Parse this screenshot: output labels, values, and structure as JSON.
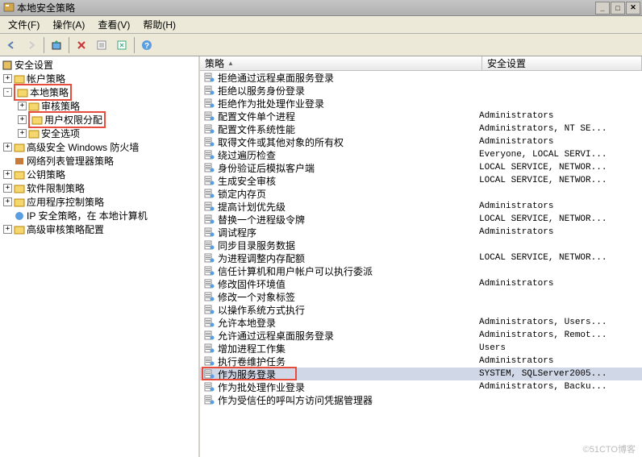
{
  "window": {
    "title": "本地安全策略"
  },
  "menu": {
    "file": "文件(F)",
    "action": "操作(A)",
    "view": "查看(V)",
    "help": "帮助(H)"
  },
  "tree": {
    "root": "安全设置",
    "account_policy": "帐户策略",
    "local_policy": "本地策略",
    "audit_policy": "审核策略",
    "user_rights": "用户权限分配",
    "security_options": "安全选项",
    "firewall": "高级安全 Windows 防火墙",
    "network_list": "网络列表管理器策略",
    "public_key": "公钥策略",
    "software_restriction": "软件限制策略",
    "app_control": "应用程序控制策略",
    "ip_security": "IP 安全策略，在 本地计算机",
    "advanced_audit": "高级审核策略配置"
  },
  "columns": {
    "policy": "策略",
    "security_setting": "安全设置"
  },
  "policies": [
    {
      "name": "拒绝通过远程桌面服务登录",
      "value": ""
    },
    {
      "name": "拒绝以服务身份登录",
      "value": ""
    },
    {
      "name": "拒绝作为批处理作业登录",
      "value": ""
    },
    {
      "name": "配置文件单个进程",
      "value": "Administrators"
    },
    {
      "name": "配置文件系统性能",
      "value": "Administrators, NT SE..."
    },
    {
      "name": "取得文件或其他对象的所有权",
      "value": "Administrators"
    },
    {
      "name": "绕过遍历检查",
      "value": "Everyone, LOCAL SERVI..."
    },
    {
      "name": "身份验证后模拟客户端",
      "value": "LOCAL SERVICE, NETWOR..."
    },
    {
      "name": "生成安全审核",
      "value": "LOCAL SERVICE, NETWOR..."
    },
    {
      "name": "锁定内存页",
      "value": ""
    },
    {
      "name": "提高计划优先级",
      "value": "Administrators"
    },
    {
      "name": "替换一个进程级令牌",
      "value": "LOCAL SERVICE, NETWOR..."
    },
    {
      "name": "调试程序",
      "value": "Administrators"
    },
    {
      "name": "同步目录服务数据",
      "value": ""
    },
    {
      "name": "为进程调整内存配额",
      "value": "LOCAL SERVICE, NETWOR..."
    },
    {
      "name": "信任计算机和用户帐户可以执行委派",
      "value": ""
    },
    {
      "name": "修改固件环境值",
      "value": "Administrators"
    },
    {
      "name": "修改一个对象标签",
      "value": ""
    },
    {
      "name": "以操作系统方式执行",
      "value": ""
    },
    {
      "name": "允许本地登录",
      "value": "Administrators, Users..."
    },
    {
      "name": "允许通过远程桌面服务登录",
      "value": "Administrators, Remot..."
    },
    {
      "name": "增加进程工作集",
      "value": "Users"
    },
    {
      "name": "执行卷维护任务",
      "value": "Administrators"
    },
    {
      "name": "作为服务登录",
      "value": "SYSTEM, SQLServer2005..."
    },
    {
      "name": "作为批处理作业登录",
      "value": "Administrators, Backu..."
    },
    {
      "name": "作为受信任的呼叫方访问凭据管理器",
      "value": ""
    }
  ],
  "watermark": "©51CTO博客",
  "colors": {
    "highlight": "#e74c3c",
    "selected_row": "#d0d8e8"
  }
}
